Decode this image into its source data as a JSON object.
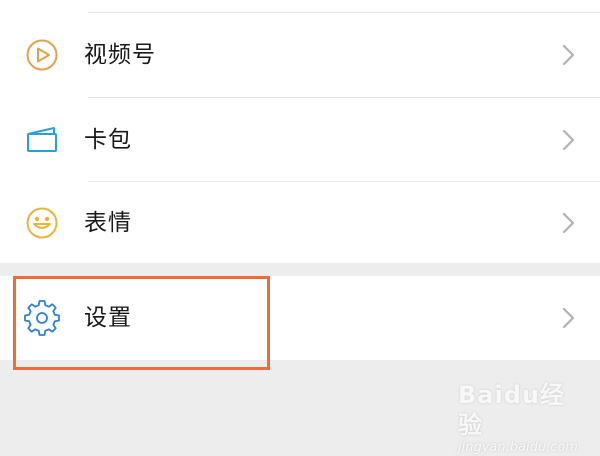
{
  "menu": {
    "items": [
      {
        "label": "视频号",
        "icon": "video-channel-icon"
      },
      {
        "label": "卡包",
        "icon": "card-wallet-icon"
      },
      {
        "label": "表情",
        "icon": "smiley-icon"
      },
      {
        "label": "设置",
        "icon": "gear-icon"
      }
    ]
  },
  "colors": {
    "video_channel_icon": "#e0a24a",
    "card_icon": "#2a9fd8",
    "smiley_icon": "#e9b43a",
    "gear_icon": "#2f7fd6",
    "highlight": "#f06a3a",
    "chevron": "#b2b2b2"
  },
  "watermark": {
    "logo": "Baidu经验",
    "sub": "jingyan.baidu.com"
  }
}
